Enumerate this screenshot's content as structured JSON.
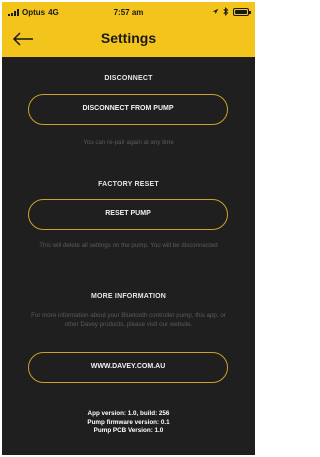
{
  "status_bar": {
    "carrier": "Optus",
    "network": "4G",
    "time": "7:57 am",
    "icons": [
      "location-icon",
      "bluetooth-icon",
      "battery-icon"
    ]
  },
  "nav": {
    "title": "Settings",
    "back_icon": "back-arrow-icon"
  },
  "disconnect": {
    "heading": "DISCONNECT",
    "button": "DISCONNECT FROM PUMP",
    "note": "You can re-pair again at any time"
  },
  "factory_reset": {
    "heading": "FACTORY RESET",
    "button": "RESET PUMP",
    "note": "This will delete all settings on the pump. You will be disconnected"
  },
  "more_info": {
    "heading": "MORE INFORMATION",
    "note": "For more information about your Bluetooth controller pump, this app, or other Davey products, please visit our website.",
    "button": "WWW.DAVEY.COM.AU"
  },
  "versions": {
    "app": "App version: 1.0, build: 256",
    "firmware": "Pump firmware version: 0.1",
    "pcb": "Pump PCB Version: 1.0"
  },
  "colors": {
    "accent": "#f3c41c",
    "background": "#1f1f1f",
    "button_border": "#c9a227",
    "muted_text": "#5b5b5b"
  }
}
